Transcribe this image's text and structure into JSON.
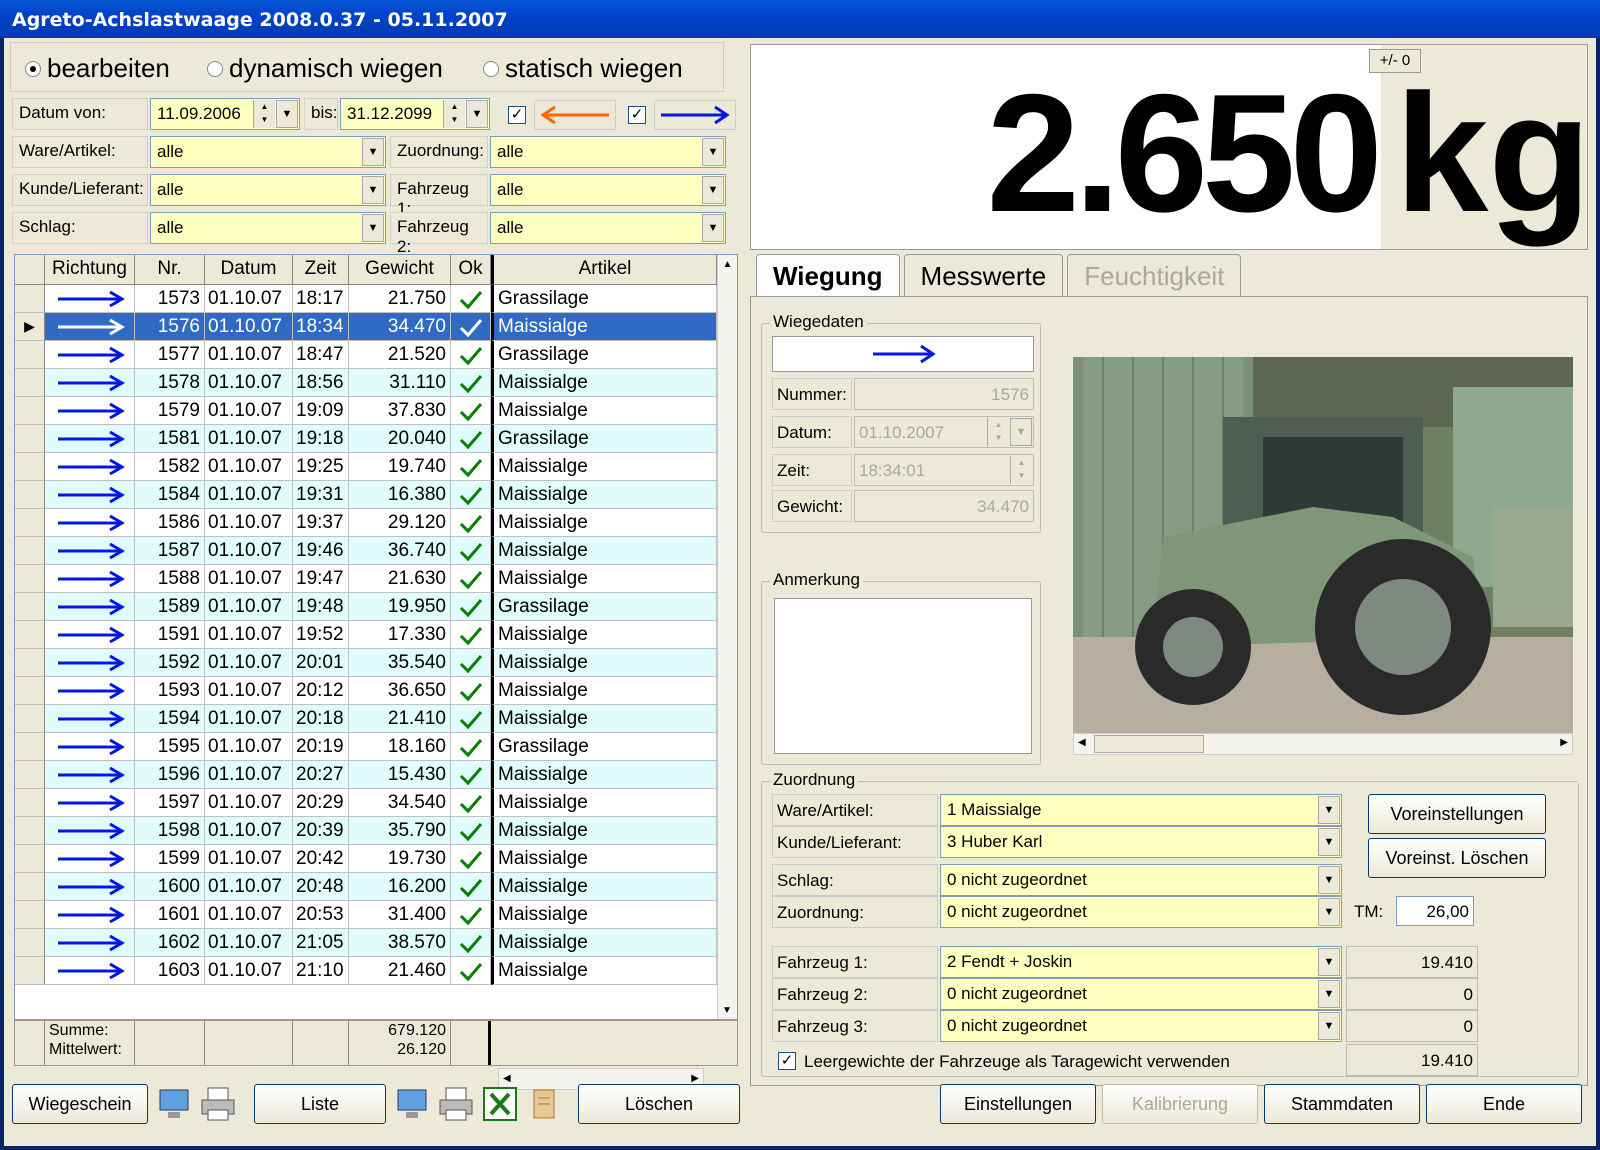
{
  "window": {
    "title": "Agreto-Achslastwaage 2008.0.37 - 05.11.2007"
  },
  "mode": {
    "options": [
      {
        "label": "bearbeiten",
        "selected": true
      },
      {
        "label": "dynamisch wiegen",
        "selected": false
      },
      {
        "label": "statisch wiegen",
        "selected": false
      }
    ]
  },
  "filters": {
    "date_from_label": "Datum von:",
    "date_from": "11.09.2006",
    "date_to_label": "bis:",
    "date_to": "31.12.2099",
    "ware_label": "Ware/Artikel:",
    "ware_value": "alle",
    "kunde_label": "Kunde/Lieferant:",
    "kunde_value": "alle",
    "schlag_label": "Schlag:",
    "schlag_value": "alle",
    "zuordnung_label": "Zuordnung:",
    "zuordnung_value": "alle",
    "fahrzeug1_label": "Fahrzeug 1:",
    "fahrzeug1_value": "alle",
    "fahrzeug2_label": "Fahrzeug 2:",
    "fahrzeug2_value": "alle",
    "colors": {
      "arrow_in": "#ff6600",
      "arrow_out": "#0018e0"
    }
  },
  "display": {
    "weight": "2.650",
    "unit": "kg",
    "tare_button": "+/- 0"
  },
  "table": {
    "columns": [
      "Richtung",
      "Nr.",
      "Datum",
      "Zeit",
      "Gewicht",
      "Ok",
      "Artikel"
    ],
    "selected_index": 1,
    "rows": [
      {
        "nr": "1573",
        "datum": "01.10.07",
        "zeit": "18:17",
        "gewicht": "21.750",
        "artikel": "Grassilage"
      },
      {
        "nr": "1576",
        "datum": "01.10.07",
        "zeit": "18:34",
        "gewicht": "34.470",
        "artikel": "Maissialge"
      },
      {
        "nr": "1577",
        "datum": "01.10.07",
        "zeit": "18:47",
        "gewicht": "21.520",
        "artikel": "Grassilage"
      },
      {
        "nr": "1578",
        "datum": "01.10.07",
        "zeit": "18:56",
        "gewicht": "31.110",
        "artikel": "Maissialge"
      },
      {
        "nr": "1579",
        "datum": "01.10.07",
        "zeit": "19:09",
        "gewicht": "37.830",
        "artikel": "Maissialge"
      },
      {
        "nr": "1581",
        "datum": "01.10.07",
        "zeit": "19:18",
        "gewicht": "20.040",
        "artikel": "Grassilage"
      },
      {
        "nr": "1582",
        "datum": "01.10.07",
        "zeit": "19:25",
        "gewicht": "19.740",
        "artikel": "Maissialge"
      },
      {
        "nr": "1584",
        "datum": "01.10.07",
        "zeit": "19:31",
        "gewicht": "16.380",
        "artikel": "Maissialge"
      },
      {
        "nr": "1586",
        "datum": "01.10.07",
        "zeit": "19:37",
        "gewicht": "29.120",
        "artikel": "Maissialge"
      },
      {
        "nr": "1587",
        "datum": "01.10.07",
        "zeit": "19:46",
        "gewicht": "36.740",
        "artikel": "Maissialge"
      },
      {
        "nr": "1588",
        "datum": "01.10.07",
        "zeit": "19:47",
        "gewicht": "21.630",
        "artikel": "Maissialge"
      },
      {
        "nr": "1589",
        "datum": "01.10.07",
        "zeit": "19:48",
        "gewicht": "19.950",
        "artikel": "Grassilage"
      },
      {
        "nr": "1591",
        "datum": "01.10.07",
        "zeit": "19:52",
        "gewicht": "17.330",
        "artikel": "Maissialge"
      },
      {
        "nr": "1592",
        "datum": "01.10.07",
        "zeit": "20:01",
        "gewicht": "35.540",
        "artikel": "Maissialge"
      },
      {
        "nr": "1593",
        "datum": "01.10.07",
        "zeit": "20:12",
        "gewicht": "36.650",
        "artikel": "Maissialge"
      },
      {
        "nr": "1594",
        "datum": "01.10.07",
        "zeit": "20:18",
        "gewicht": "21.410",
        "artikel": "Maissialge"
      },
      {
        "nr": "1595",
        "datum": "01.10.07",
        "zeit": "20:19",
        "gewicht": "18.160",
        "artikel": "Grassilage"
      },
      {
        "nr": "1596",
        "datum": "01.10.07",
        "zeit": "20:27",
        "gewicht": "15.430",
        "artikel": "Maissialge"
      },
      {
        "nr": "1597",
        "datum": "01.10.07",
        "zeit": "20:29",
        "gewicht": "34.540",
        "artikel": "Maissialge"
      },
      {
        "nr": "1598",
        "datum": "01.10.07",
        "zeit": "20:39",
        "gewicht": "35.790",
        "artikel": "Maissialge"
      },
      {
        "nr": "1599",
        "datum": "01.10.07",
        "zeit": "20:42",
        "gewicht": "19.730",
        "artikel": "Maissialge"
      },
      {
        "nr": "1600",
        "datum": "01.10.07",
        "zeit": "20:48",
        "gewicht": "16.200",
        "artikel": "Maissialge"
      },
      {
        "nr": "1601",
        "datum": "01.10.07",
        "zeit": "20:53",
        "gewicht": "31.400",
        "artikel": "Maissialge"
      },
      {
        "nr": "1602",
        "datum": "01.10.07",
        "zeit": "21:05",
        "gewicht": "38.570",
        "artikel": "Maissialge"
      },
      {
        "nr": "1603",
        "datum": "01.10.07",
        "zeit": "21:10",
        "gewicht": "21.460",
        "artikel": "Maissialge"
      }
    ],
    "summary": {
      "summe_label": "Summe:",
      "mittelwert_label": "Mittelwert:",
      "summe": "679.120",
      "mittelwert": "26.120"
    },
    "colors": {
      "row_alt": "#e0fcfc",
      "row_selected": "#316ac5",
      "check": "#008000"
    }
  },
  "tabs": [
    {
      "label": "Wiegung",
      "state": "active"
    },
    {
      "label": "Messwerte",
      "state": "normal"
    },
    {
      "label": "Feuchtigkeit",
      "state": "disabled"
    }
  ],
  "wiegedaten": {
    "title": "Wiegedaten",
    "nummer_label": "Nummer:",
    "nummer": "1576",
    "datum_label": "Datum:",
    "datum": "01.10.2007",
    "zeit_label": "Zeit:",
    "zeit": "18:34:01",
    "gewicht_label": "Gewicht:",
    "gewicht": "34.470"
  },
  "anmerkung": {
    "title": "Anmerkung",
    "text": ""
  },
  "zuordnung": {
    "title": "Zuordnung",
    "ware_label": "Ware/Artikel:",
    "ware_value": "1 Maissialge",
    "kunde_label": "Kunde/Lieferant:",
    "kunde_value": "3 Huber Karl",
    "schlag_label": "Schlag:",
    "schlag_value": "0 nicht zugeordnet",
    "zuordnung_label": "Zuordnung:",
    "zuordnung_value": "0 nicht zugeordnet",
    "tm_label": "TM:",
    "tm_value": "26,00",
    "fahrzeug1_label": "Fahrzeug 1:",
    "fahrzeug1_value": "2 Fendt + Joskin",
    "fahrzeug1_weight": "19.410",
    "fahrzeug2_label": "Fahrzeug 2:",
    "fahrzeug2_value": "0 nicht zugeordnet",
    "fahrzeug2_weight": "0",
    "fahrzeug3_label": "Fahrzeug 3:",
    "fahrzeug3_value": "0 nicht zugeordnet",
    "fahrzeug3_weight": "0",
    "leergewicht_label": "Leergewichte der Fahrzeuge als Taragewicht verwenden",
    "leergewicht_value": "19.410",
    "voreinstellungen_button": "Voreinstellungen",
    "voreinst_loeschen_button": "Voreinst. Löschen"
  },
  "bottom": {
    "wiegeschein": "Wiegeschein",
    "liste": "Liste",
    "loeschen": "Löschen",
    "einstellungen": "Einstellungen",
    "kalibrierung": "Kalibrierung",
    "stammdaten": "Stammdaten",
    "ende": "Ende"
  }
}
